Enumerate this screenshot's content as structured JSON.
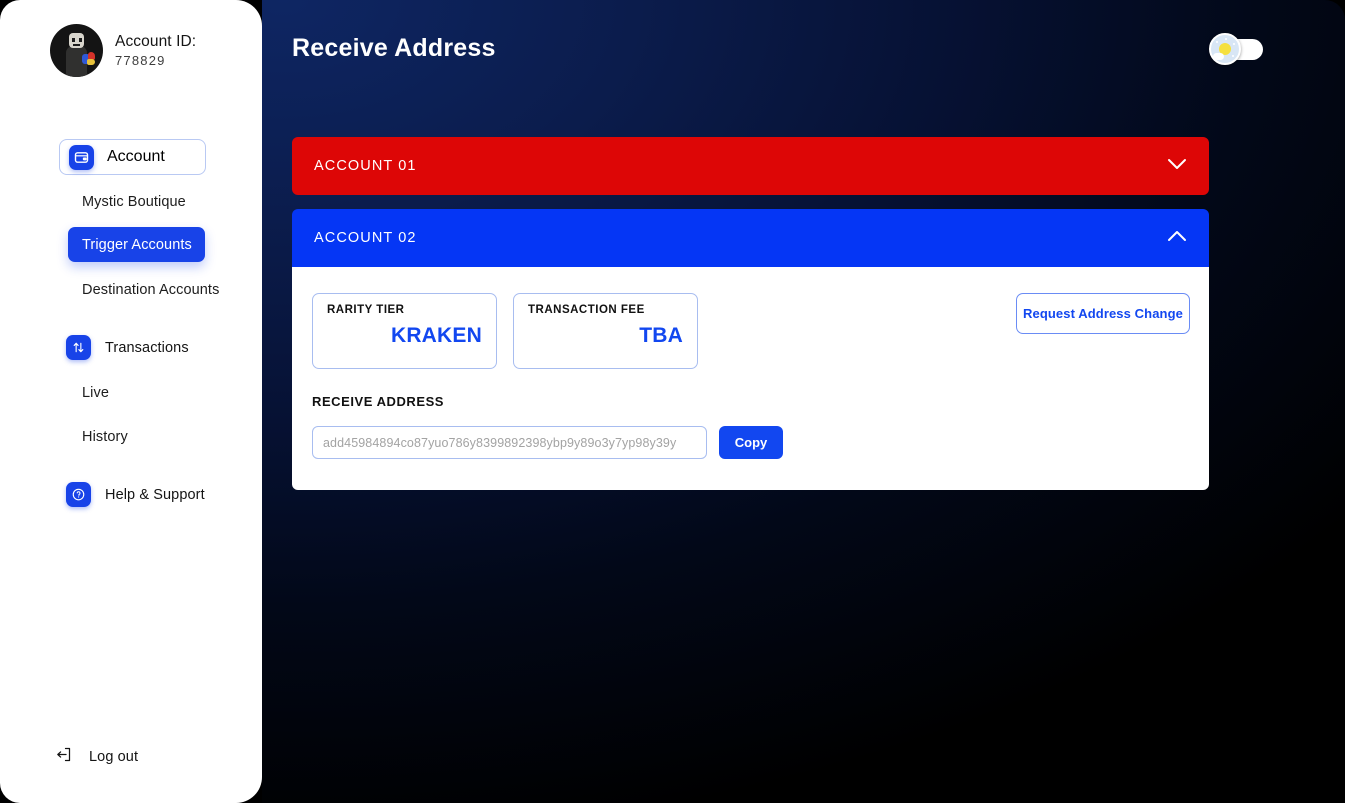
{
  "sidebar": {
    "account": {
      "label": "Account ID:",
      "id": "778829",
      "avatar_icon": "pixel-avatar-icon"
    },
    "nav": {
      "account_item": {
        "label": "Account",
        "icon": "wallet-icon"
      },
      "mystic_boutique": "Mystic Boutique",
      "trigger_accounts": "Trigger Accounts",
      "destination_accounts": "Destination Accounts",
      "transactions": {
        "label": "Transactions",
        "icon": "exchange-arrows-icon"
      },
      "live": "Live",
      "history": "History",
      "help": {
        "label": "Help & Support",
        "icon": "question-circle-icon"
      }
    },
    "logout": {
      "label": "Log out",
      "icon": "logout-arrow-icon"
    }
  },
  "header": {
    "title": "Receive Address",
    "theme_toggle": {
      "icon": "sun-cloud-icon",
      "state": "off"
    }
  },
  "accounts": [
    {
      "title": "ACCOUNT 01",
      "color": "#dd0606",
      "expanded": false,
      "chevron": "chevron-down-icon"
    },
    {
      "title": "ACCOUNT 02",
      "color": "#0536f5",
      "expanded": true,
      "chevron": "chevron-up-icon",
      "details": {
        "stats": [
          {
            "label": "RARITY TIER",
            "value": "KRAKEN"
          },
          {
            "label": "TRANSACTION FEE",
            "value": "TBA"
          }
        ],
        "request_button": "Request Address Change",
        "address_section_title": "RECEIVE ADDRESS",
        "address_placeholder": "add45984894co87yuo786y8399892398ybp9y89o3y7yp98y39y",
        "address_value": "",
        "copy_button": "Copy"
      }
    }
  ],
  "colors": {
    "accent_blue": "#1247f0",
    "account01_red": "#dd0606",
    "account02_blue": "#0536f5",
    "sidebar_bg": "#ffffff",
    "main_bg_top": "#0e2663",
    "main_bg_bottom": "#000000"
  }
}
